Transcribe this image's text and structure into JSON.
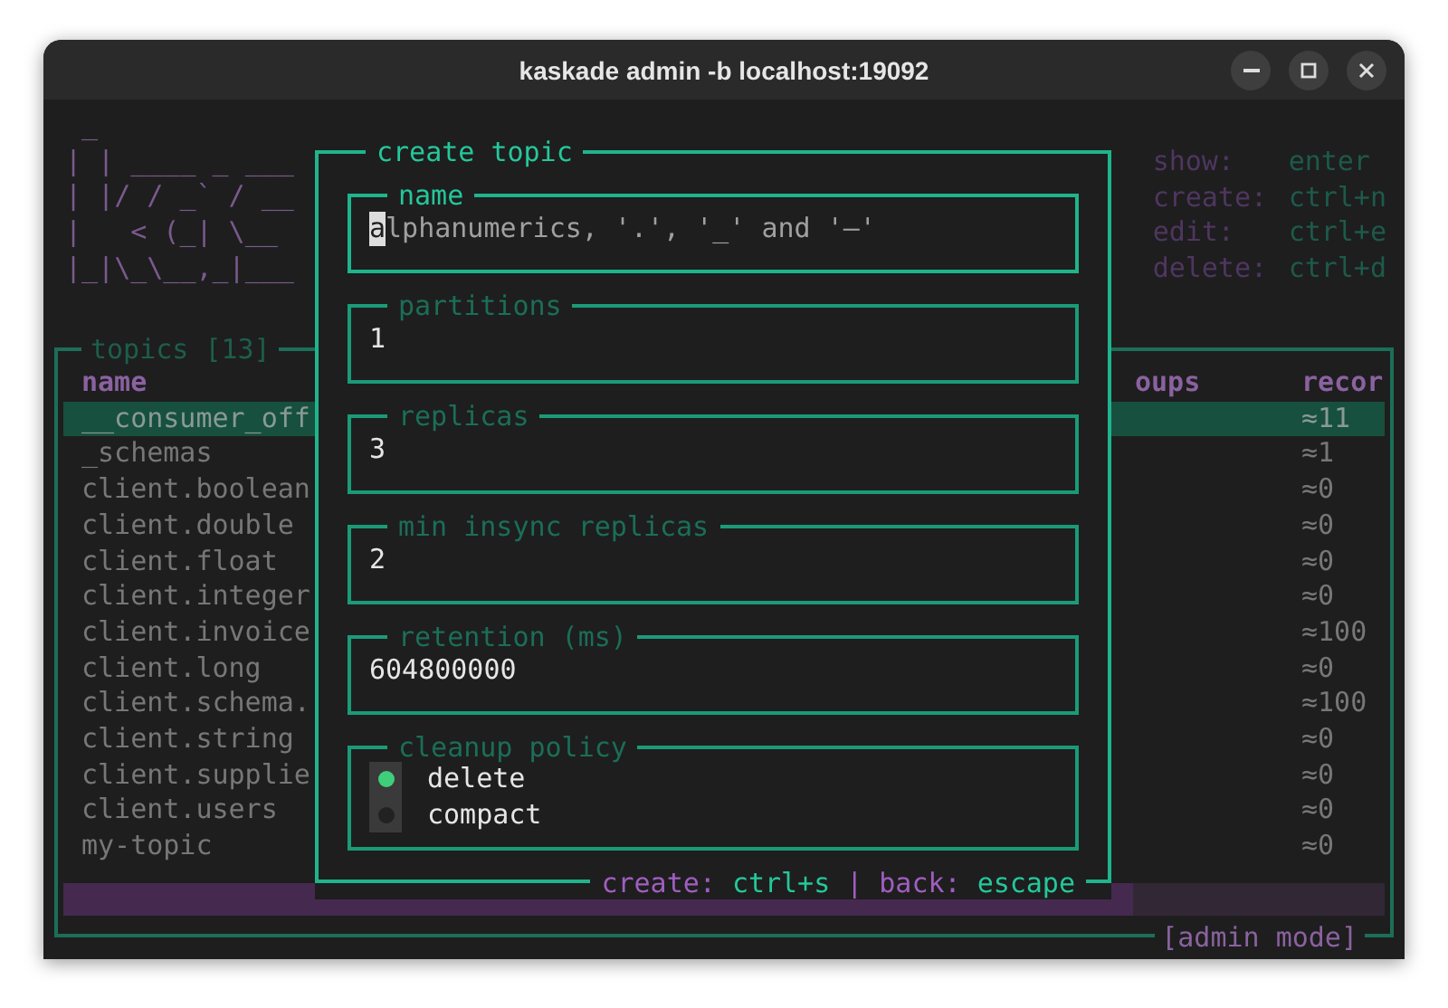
{
  "window": {
    "title": "kaskade admin -b localhost:19092"
  },
  "logo_lines": [
    " _",
    "| | ____ _ ___",
    "| |/ / _` / __",
    "|   < (_| \\__ ",
    "|_|\\_\\__,_|___"
  ],
  "shortcuts": [
    {
      "label": "show:",
      "key": "enter"
    },
    {
      "label": "create:",
      "key": "ctrl+n"
    },
    {
      "label": "edit:",
      "key": "ctrl+e"
    },
    {
      "label": "delete:",
      "key": "ctrl+d"
    }
  ],
  "topics": {
    "title": "topics [13]",
    "columns": [
      "name",
      "oups",
      "recor"
    ],
    "rows": [
      {
        "name": "__consumer_off",
        "records": "≈11",
        "selected": true
      },
      {
        "name": "_schemas",
        "records": "≈1",
        "selected": false
      },
      {
        "name": "client.boolean",
        "records": "≈0",
        "selected": false
      },
      {
        "name": "client.double",
        "records": "≈0",
        "selected": false
      },
      {
        "name": "client.float",
        "records": "≈0",
        "selected": false
      },
      {
        "name": "client.integer",
        "records": "≈0",
        "selected": false
      },
      {
        "name": "client.invoice",
        "records": "≈100",
        "selected": false
      },
      {
        "name": "client.long",
        "records": "≈0",
        "selected": false
      },
      {
        "name": "client.schema.",
        "records": "≈100",
        "selected": false
      },
      {
        "name": "client.string",
        "records": "≈0",
        "selected": false
      },
      {
        "name": "client.supplie",
        "records": "≈0",
        "selected": false
      },
      {
        "name": "client.users",
        "records": "≈0",
        "selected": false
      },
      {
        "name": "my-topic",
        "records": "≈0",
        "selected": false
      }
    ],
    "progress": {
      "level": 0.81
    },
    "mode": "[admin mode]"
  },
  "dialog": {
    "title": "create topic",
    "fields": [
      {
        "kind": "text",
        "label": "name",
        "placeholder": "alphanumerics, '.', '_' and '–'",
        "focused": true
      },
      {
        "kind": "text",
        "label": "partitions",
        "value": "1",
        "focused": false
      },
      {
        "kind": "text",
        "label": "replicas",
        "value": "3",
        "focused": false
      },
      {
        "kind": "text",
        "label": "min insync replicas",
        "value": "2",
        "focused": false
      },
      {
        "kind": "text",
        "label": "retention (ms)",
        "value": "604800000",
        "focused": false
      },
      {
        "kind": "radio",
        "label": "cleanup policy",
        "focused": false,
        "options": [
          {
            "label": "delete",
            "selected": true
          },
          {
            "label": "compact",
            "selected": false
          }
        ]
      }
    ],
    "footer": [
      {
        "label": "create:",
        "key": "ctrl+s"
      },
      {
        "label": "back:",
        "key": "escape"
      }
    ],
    "footer_separator": "|"
  }
}
